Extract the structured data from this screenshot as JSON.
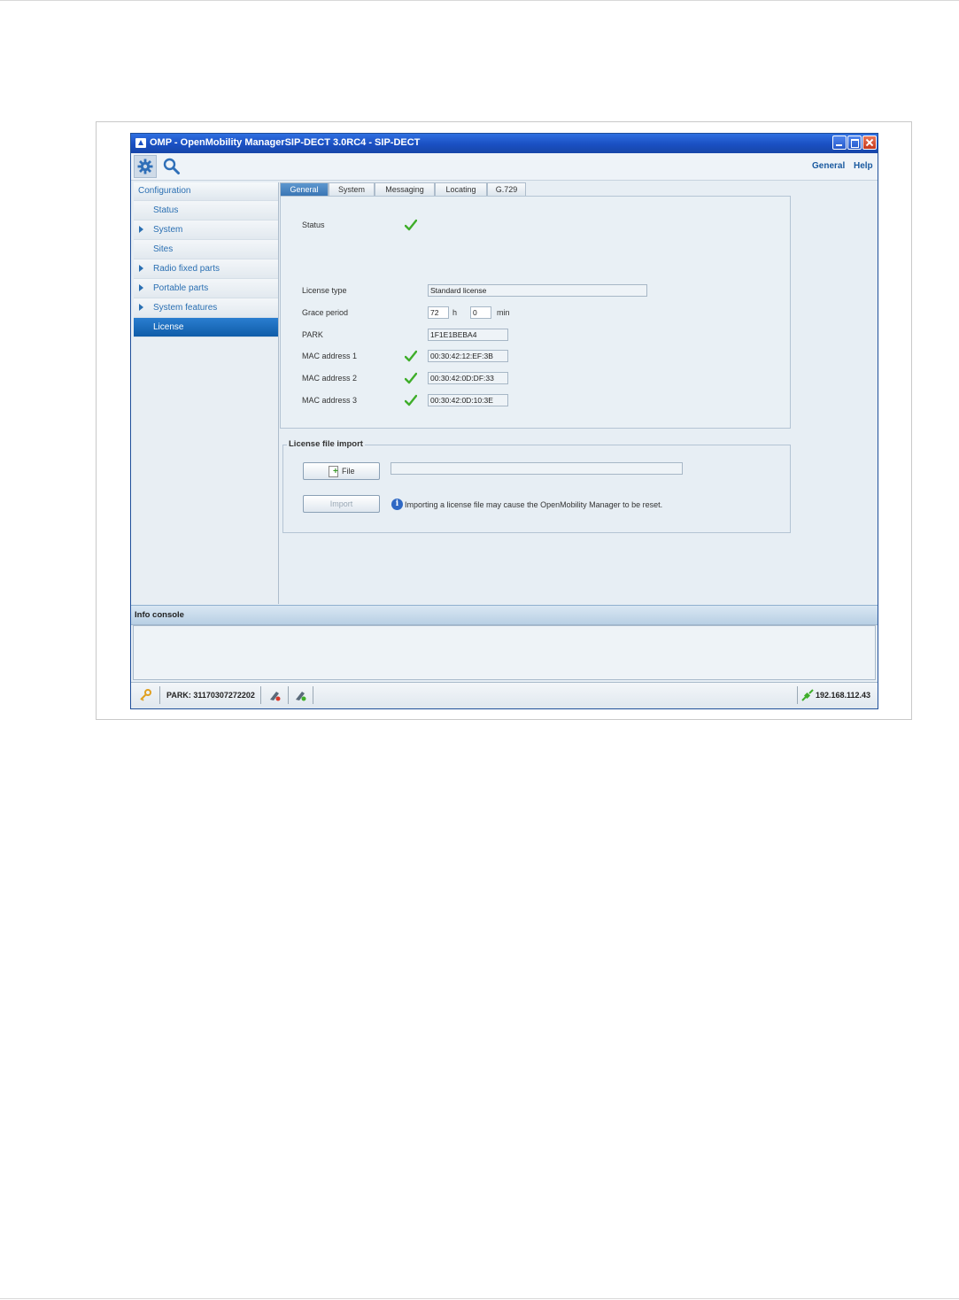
{
  "window": {
    "title": "OMP - OpenMobility ManagerSIP-DECT 3.0RC4 - SIP-DECT"
  },
  "toolbar": {
    "menu_general": "General",
    "menu_help": "Help"
  },
  "sidebar": {
    "heading": "Configuration",
    "items": [
      {
        "label": "Status",
        "expandable": false
      },
      {
        "label": "System",
        "expandable": true
      },
      {
        "label": "Sites",
        "expandable": false
      },
      {
        "label": "Radio fixed parts",
        "expandable": true
      },
      {
        "label": "Portable parts",
        "expandable": true
      },
      {
        "label": "System features",
        "expandable": true
      },
      {
        "label": "License",
        "expandable": false,
        "active": true
      }
    ]
  },
  "tabs": [
    "General",
    "System",
    "Messaging",
    "Locating",
    "G.729"
  ],
  "general": {
    "status_label": "Status",
    "license_type_label": "License type",
    "license_type_value": "Standard license",
    "grace_period_label": "Grace period",
    "grace_hours": "72",
    "hours_unit": "h",
    "grace_minutes": "0",
    "minutes_unit": "min",
    "park_label": "PARK",
    "park_value": "1F1E1BEBA4",
    "mac1_label": "MAC address 1",
    "mac1_value": "00:30:42:12:EF:3B",
    "mac2_label": "MAC address 2",
    "mac2_value": "00:30:42:0D:DF:33",
    "mac3_label": "MAC address 3",
    "mac3_value": "00:30:42:0D:10:3E"
  },
  "license_import": {
    "title": "License file import",
    "file_button": "File",
    "file_path": "",
    "import_button": "Import",
    "notice": "Importing a license file may cause the OpenMobility Manager to be reset."
  },
  "console": {
    "title": "Info console"
  },
  "statusbar": {
    "park": "PARK: 31170307272202",
    "ip": "192.168.112.43"
  },
  "colors": {
    "titlebar": "#1a4fc2",
    "accent_link": "#2a6fb2",
    "active_nav": "#0f5ca8",
    "check_green": "#3fae2a"
  }
}
